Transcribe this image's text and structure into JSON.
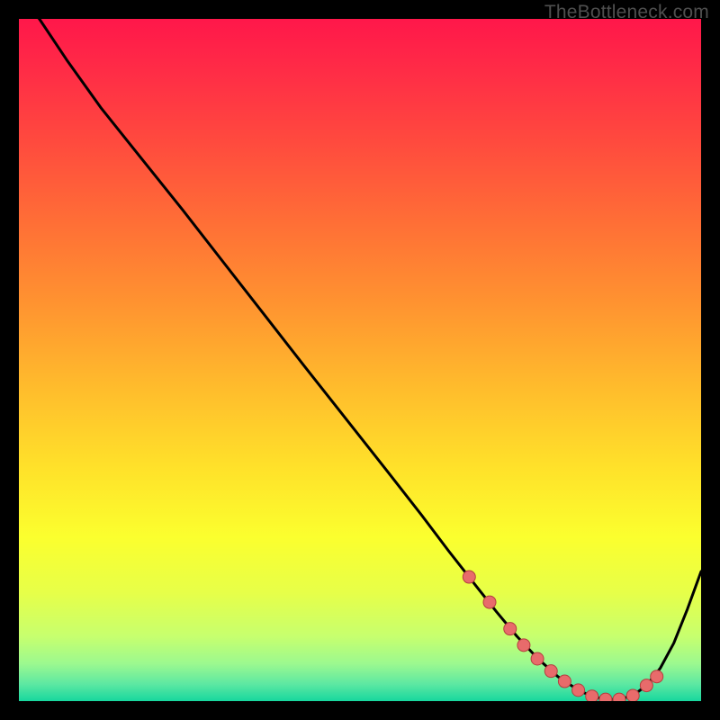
{
  "attribution": "TheBottleneck.com",
  "colors": {
    "black": "#000000",
    "curve": "#000000",
    "marker_fill": "#e86b6b",
    "marker_stroke": "#b43f3f"
  },
  "gradient_stops": [
    {
      "offset": 0.0,
      "color": "#ff174a"
    },
    {
      "offset": 0.08,
      "color": "#ff2d46"
    },
    {
      "offset": 0.18,
      "color": "#ff4a3e"
    },
    {
      "offset": 0.3,
      "color": "#ff6f36"
    },
    {
      "offset": 0.42,
      "color": "#ff9430"
    },
    {
      "offset": 0.55,
      "color": "#ffbf2c"
    },
    {
      "offset": 0.66,
      "color": "#ffe22a"
    },
    {
      "offset": 0.76,
      "color": "#fbff2e"
    },
    {
      "offset": 0.84,
      "color": "#e7ff48"
    },
    {
      "offset": 0.905,
      "color": "#c7ff6e"
    },
    {
      "offset": 0.945,
      "color": "#9cf98f"
    },
    {
      "offset": 0.975,
      "color": "#5de8a2"
    },
    {
      "offset": 1.0,
      "color": "#17d79e"
    }
  ],
  "chart_data": {
    "type": "line",
    "title": "",
    "xlabel": "",
    "ylabel": "",
    "xlim": [
      0,
      100
    ],
    "ylim": [
      0,
      100
    ],
    "x": [
      0,
      3,
      7,
      12,
      18,
      24,
      30,
      36,
      42,
      48,
      54,
      59,
      63,
      67,
      70,
      73,
      76,
      79,
      82,
      84,
      86,
      88,
      90,
      92,
      94,
      96,
      98,
      100
    ],
    "values": [
      103,
      100,
      94,
      87,
      79.5,
      72,
      64.3,
      56.6,
      48.9,
      41.3,
      33.7,
      27.3,
      22,
      16.9,
      13.1,
      9.5,
      6.3,
      3.6,
      1.6,
      0.7,
      0.25,
      0.25,
      0.8,
      2.3,
      4.8,
      8.5,
      13.5,
      19
    ],
    "markers": {
      "x": [
        66,
        69,
        72,
        74,
        76,
        78,
        80,
        82,
        84,
        86,
        88,
        90,
        92,
        93.5
      ],
      "y": [
        18.2,
        14.5,
        10.6,
        8.2,
        6.2,
        4.4,
        2.9,
        1.6,
        0.7,
        0.25,
        0.25,
        0.8,
        2.3,
        3.6
      ]
    }
  }
}
